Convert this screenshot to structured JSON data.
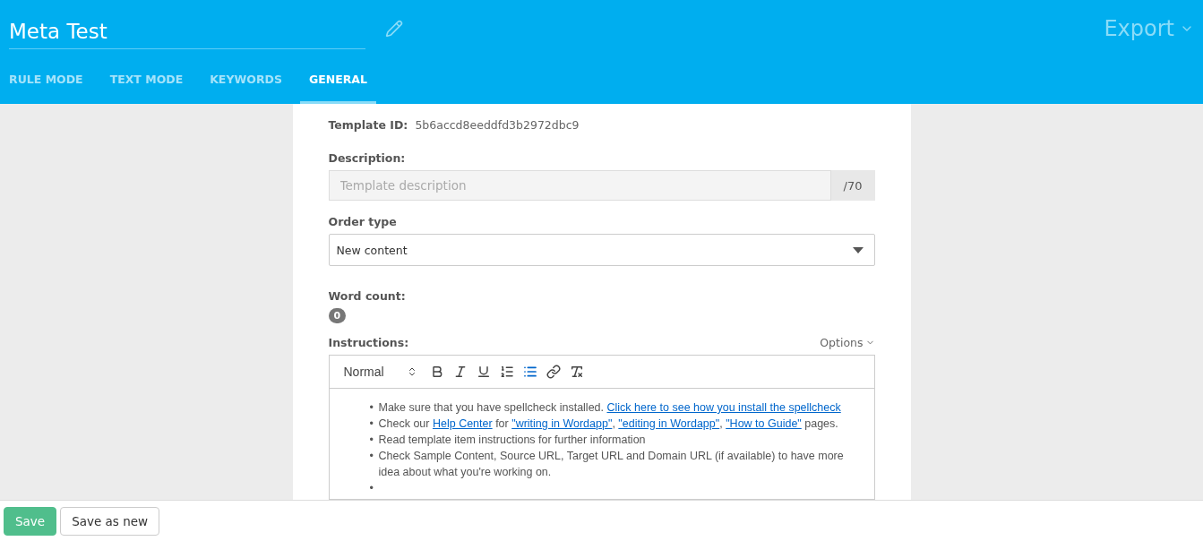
{
  "header": {
    "title": "Meta Test",
    "export": "Export"
  },
  "tabs": [
    {
      "label": "RULE MODE",
      "selected": false
    },
    {
      "label": "TEXT MODE",
      "selected": false
    },
    {
      "label": "KEYWORDS",
      "selected": false
    },
    {
      "label": "GENERAL",
      "selected": true
    }
  ],
  "template_id": {
    "label": "Template ID:",
    "value": "5b6accd8eeddfd3b2972dbc9"
  },
  "description": {
    "label": "Description:",
    "placeholder": "Template description",
    "counter": "/70"
  },
  "order_type": {
    "label": "Order type",
    "value": "New content"
  },
  "word_count": {
    "label": "Word count:",
    "value": "0"
  },
  "instructions": {
    "label": "Instructions:",
    "options": "Options",
    "format": "Normal",
    "toolbar": [
      {
        "kind": "bold",
        "active": false
      },
      {
        "kind": "italic",
        "active": false
      },
      {
        "kind": "underline",
        "active": false
      },
      {
        "kind": "ordered",
        "active": false
      },
      {
        "kind": "bullet",
        "active": true
      },
      {
        "kind": "link",
        "active": false
      },
      {
        "kind": "clear",
        "active": false
      }
    ],
    "items": [
      {
        "bullet": "•",
        "segments": [
          {
            "kind": "text",
            "text": "Make sure that you have spellcheck installed. "
          },
          {
            "kind": "link",
            "text": "Click here to see how you install the spellcheck"
          }
        ]
      },
      {
        "bullet": "•",
        "segments": [
          {
            "kind": "text",
            "text": "Check our "
          },
          {
            "kind": "link",
            "text": "Help Center"
          },
          {
            "kind": "text",
            "text": " for "
          },
          {
            "kind": "link",
            "text": "\"writing in Wordapp\""
          },
          {
            "kind": "text",
            "text": ", "
          },
          {
            "kind": "link",
            "text": "\"editing in Wordapp\""
          },
          {
            "kind": "text",
            "text": ", "
          },
          {
            "kind": "link",
            "text": "\"How to Guide\""
          },
          {
            "kind": "text",
            "text": " pages."
          }
        ]
      },
      {
        "bullet": "•",
        "segments": [
          {
            "kind": "text",
            "text": "Read template item instructions for further information"
          }
        ]
      },
      {
        "bullet": "•",
        "segments": [
          {
            "kind": "text",
            "text": "Check Sample Content, Source URL, Target URL and Domain URL (if available) to have more idea about what you're working on."
          }
        ]
      },
      {
        "bullet": "•"
      }
    ]
  },
  "footer": {
    "buttons": [
      {
        "label": "Save",
        "kind": "primary"
      },
      {
        "label": "Save as new",
        "kind": "default"
      }
    ]
  }
}
